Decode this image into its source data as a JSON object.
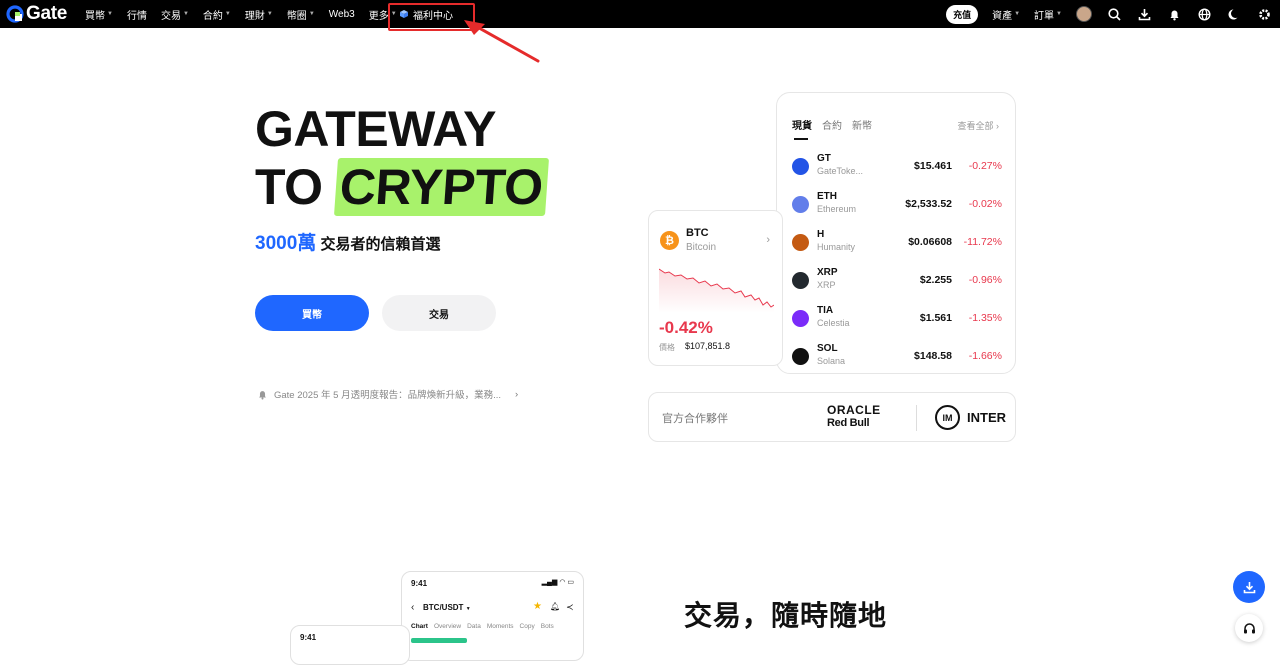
{
  "nav": {
    "logo": "Gate",
    "items": [
      {
        "label": "買幣",
        "caret": true
      },
      {
        "label": "行情",
        "caret": false
      },
      {
        "label": "交易",
        "caret": true
      },
      {
        "label": "合約",
        "caret": true
      },
      {
        "label": "理財",
        "caret": true
      },
      {
        "label": "幣圈",
        "caret": true
      },
      {
        "label": "Web3",
        "caret": false
      },
      {
        "label": "更多",
        "caret": true
      }
    ],
    "welfare": "福利中心",
    "deposit": "充值",
    "assets": "資產",
    "orders": "訂單"
  },
  "hero": {
    "line1": "GATEWAY",
    "line2a": "TO",
    "line2b": "CRYPTO",
    "tag_num": "3000萬",
    "tag_text": "交易者的信賴首選",
    "buy_label": "買幣",
    "trade_label": "交易",
    "notice": "Gate 2025 年 5 月透明度報告：品牌煥新升級，業務..."
  },
  "market": {
    "tabs": [
      "現貨",
      "合約",
      "新幣"
    ],
    "view_all": "查看全部",
    "rows": [
      {
        "symbol": "GT",
        "name": "GateToke...",
        "price": "$15.461",
        "change": "-0.27%",
        "color": "#2354e6"
      },
      {
        "symbol": "ETH",
        "name": "Ethereum",
        "price": "$2,533.52",
        "change": "-0.02%",
        "color": "#627eea"
      },
      {
        "symbol": "H",
        "name": "Humanity",
        "price": "$0.06608",
        "change": "-11.72%",
        "color": "#c45a12"
      },
      {
        "symbol": "XRP",
        "name": "XRP",
        "price": "$2.255",
        "change": "-0.96%",
        "color": "#23292f"
      },
      {
        "symbol": "TIA",
        "name": "Celestia",
        "price": "$1.561",
        "change": "-1.35%",
        "color": "#7b2bf9"
      },
      {
        "symbol": "SOL",
        "name": "Solana",
        "price": "$148.58",
        "change": "-1.66%",
        "color": "#111111"
      }
    ]
  },
  "btc_card": {
    "symbol": "BTC",
    "name": "Bitcoin",
    "change": "-0.42%",
    "price_label": "價格",
    "price": "$107,851.8"
  },
  "partners": {
    "label": "官方合作夥伴",
    "oracle": "ORACLE",
    "redbull": "Red Bull",
    "inter": "INTER"
  },
  "phone": {
    "time": "9:41",
    "pair": "BTC/USDT",
    "tabs": [
      "Chart",
      "Overview",
      "Data",
      "Moments",
      "Copy",
      "Bots"
    ],
    "time2": "9:41"
  },
  "section": {
    "title": "交易，隨時隨地"
  }
}
